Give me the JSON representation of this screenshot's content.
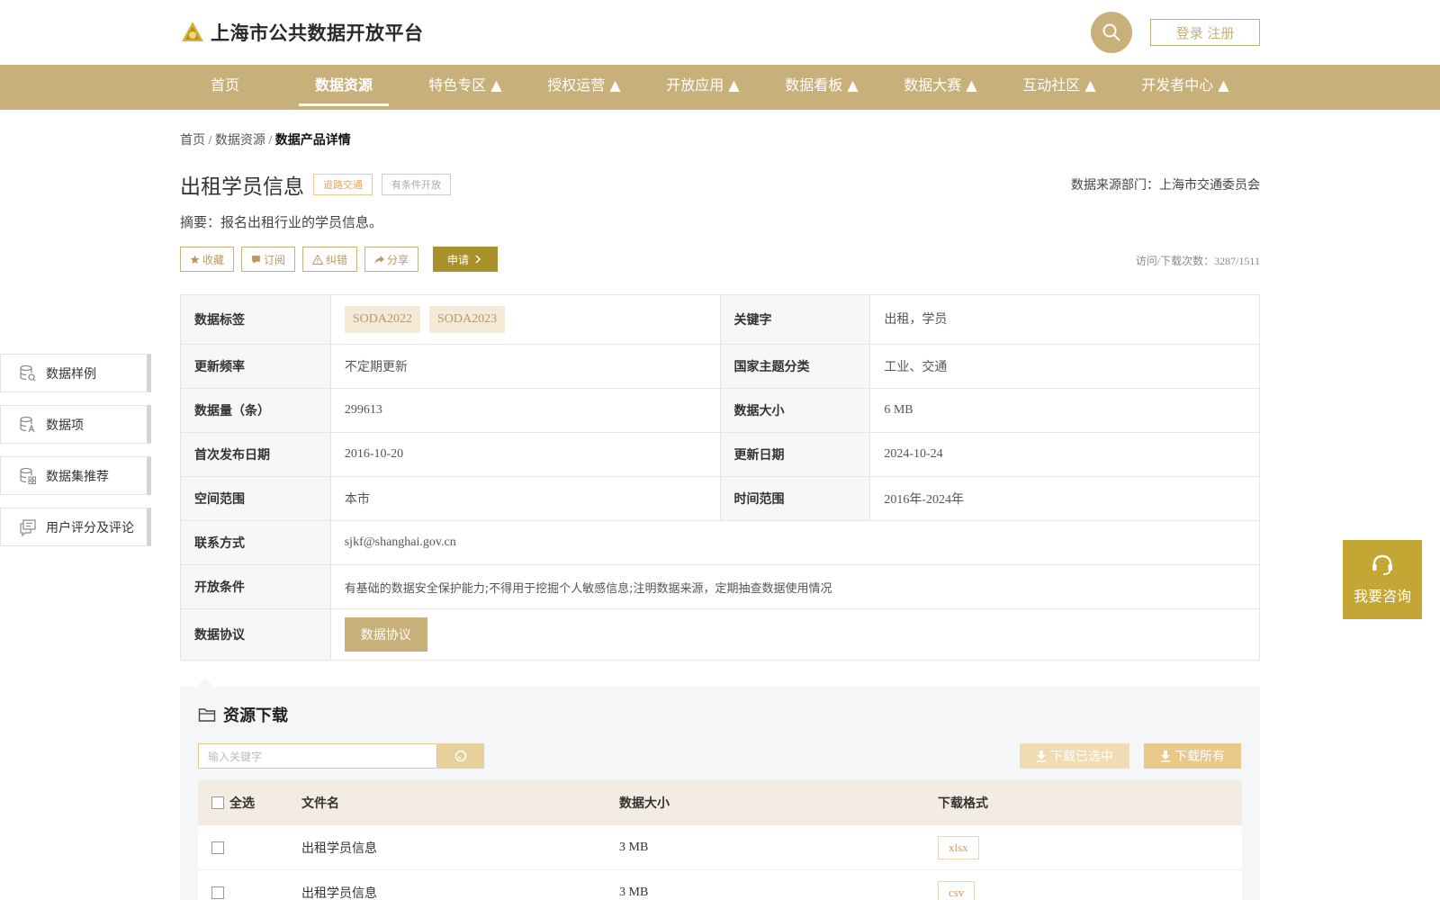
{
  "header": {
    "site_title": "上海市公共数据开放平台",
    "login_label": "登录 注册",
    "brand_color": "#c8b07a"
  },
  "nav": {
    "items": [
      {
        "label": "首页"
      },
      {
        "label": "数据资源",
        "active": true
      },
      {
        "label": "特色专区 ▲"
      },
      {
        "label": "授权运营 ▲"
      },
      {
        "label": "开放应用 ▲"
      },
      {
        "label": "数据看板 ▲"
      },
      {
        "label": "数据大赛 ▲"
      },
      {
        "label": "互动社区 ▲"
      },
      {
        "label": "开发者中心 ▲"
      }
    ]
  },
  "breadcrumb": {
    "home": "首页",
    "sep1": " / ",
    "resources": "数据资源",
    "sep2": " / ",
    "current": "数据产品详情"
  },
  "dataset": {
    "title": "出租学员信息",
    "tag_category": "道路交通",
    "tag_open": "有条件开放",
    "source": "数据来源部门：上海市交通委员会",
    "summary": "摘要：报名出租行业的学员信息。",
    "visits": "访问/下载次数：3287/1511"
  },
  "actions": {
    "favorite": "收藏",
    "subscribe": "订阅",
    "report": "纠错",
    "share": "分享",
    "apply": "申请"
  },
  "info": {
    "tags_label": "数据标签",
    "tags": [
      "SODA2022",
      "SODA2023"
    ],
    "keywords_label": "关键字",
    "keywords": "出租，学员",
    "freq_label": "更新频率",
    "freq": "不定期更新",
    "theme_label": "国家主题分类",
    "theme": "工业、交通",
    "count_label": "数据量（条）",
    "count": "299613",
    "size_label": "数据大小",
    "size": "6 MB",
    "first_label": "首次发布日期",
    "first": "2016-10-20",
    "updated_label": "更新日期",
    "updated": "2024-10-24",
    "space_label": "空间范围",
    "space": "本市",
    "time_label": "时间范围",
    "time": "2016年-2024年",
    "contact_label": "联系方式",
    "contact": "sjkf@shanghai.gov.cn",
    "cond_label": "开放条件",
    "cond": "有基础的数据安全保护能力;不得用于挖掘个人敏感信息;注明数据来源，定期抽查数据使用情况",
    "protocol_label": "数据协议",
    "protocol_btn": "数据协议"
  },
  "sidenav": {
    "items": [
      {
        "label": "数据样例",
        "icon": "database-search-icon"
      },
      {
        "label": "数据项",
        "icon": "database-text-icon"
      },
      {
        "label": "数据集推荐",
        "icon": "database-grid-icon"
      },
      {
        "label": "用户评分及评论",
        "icon": "comment-icon"
      }
    ]
  },
  "consult": {
    "label": "我要咨询"
  },
  "download": {
    "title": "资源下载",
    "search_placeholder": "输入关键字",
    "download_selected": "下载已选中",
    "download_all": "下载所有",
    "columns": {
      "select_all": "全选",
      "filename": "文件名",
      "size": "数据大小",
      "format": "下载格式"
    },
    "rows": [
      {
        "filename": "出租学员信息",
        "size": "3 MB",
        "format": "xlsx"
      },
      {
        "filename": "出租学员信息",
        "size": "3 MB",
        "format": "csv"
      }
    ]
  }
}
